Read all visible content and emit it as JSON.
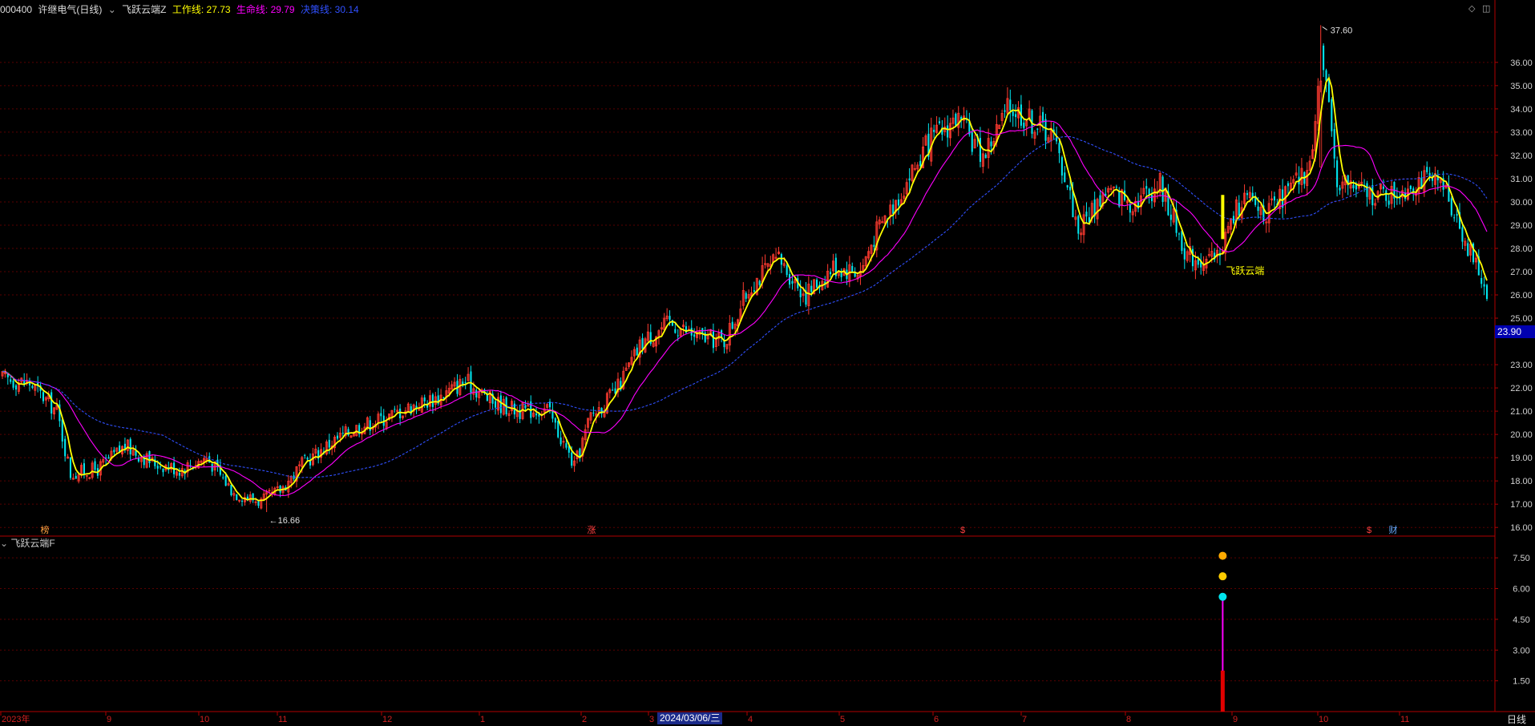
{
  "header": {
    "stock_code": "000400",
    "stock_name": "许继电气(日线)",
    "indicator_name": "飞跃云端Z",
    "work_line_label": "工作线:",
    "work_line_value": "27.73",
    "life_line_label": "生命线:",
    "life_line_value": "29.79",
    "decision_line_label": "决策线:",
    "decision_line_value": "30.14",
    "colors": {
      "work": "#ffff00",
      "life": "#ff00ff",
      "decision": "#3050ff"
    }
  },
  "sub_indicator": {
    "name": "飞跃云端F"
  },
  "current_price_badge": "23.90",
  "period_label": "日线",
  "crosshair_date": "2024/03/06/三",
  "icons": [
    "diamond-icon",
    "panel-toggle-icon",
    "collapse-icon"
  ],
  "chart_data": [
    {
      "type": "candlestick",
      "title": "",
      "ylim": [
        15.8,
        38.2
      ],
      "y_ticks": [
        "16.00",
        "17.00",
        "18.00",
        "19.00",
        "20.00",
        "21.00",
        "22.00",
        "23.00",
        "25.00",
        "26.00",
        "27.00",
        "28.00",
        "29.00",
        "30.00",
        "31.00",
        "32.00",
        "33.00",
        "34.00",
        "35.00",
        "36.00"
      ],
      "x_month_labels": [
        "2023年",
        "9",
        "10",
        "11",
        "12",
        "1",
        "2",
        "3",
        "4",
        "5",
        "6",
        "7",
        "8",
        "9",
        "10",
        "11"
      ],
      "annotations": {
        "high_label": "37.60",
        "low_label": "←16.66",
        "signal_label": "飞跃云端"
      },
      "markers": [
        "榜",
        "涨",
        "$",
        "$",
        "财"
      ],
      "anchors": [
        [
          0,
          22.4
        ],
        [
          10,
          22.2
        ],
        [
          20,
          21.0
        ],
        [
          25,
          18.3
        ],
        [
          35,
          18.5
        ],
        [
          45,
          19.5
        ],
        [
          55,
          18.8
        ],
        [
          65,
          18.5
        ],
        [
          75,
          19.0
        ],
        [
          85,
          17.5
        ],
        [
          95,
          17.1
        ],
        [
          102,
          17.6
        ],
        [
          110,
          18.7
        ],
        [
          120,
          19.6
        ],
        [
          130,
          20.3
        ],
        [
          140,
          20.7
        ],
        [
          150,
          21.2
        ],
        [
          160,
          21.6
        ],
        [
          170,
          22.3
        ],
        [
          180,
          21.4
        ],
        [
          190,
          21.0
        ],
        [
          200,
          21.1
        ],
        [
          210,
          18.6
        ],
        [
          216,
          20.8
        ],
        [
          225,
          21.8
        ],
        [
          235,
          24.0
        ],
        [
          245,
          24.8
        ],
        [
          255,
          24.2
        ],
        [
          265,
          24.0
        ],
        [
          275,
          26.5
        ],
        [
          285,
          27.5
        ],
        [
          295,
          26.0
        ],
        [
          305,
          27.2
        ],
        [
          315,
          27.0
        ],
        [
          320,
          28.5
        ],
        [
          330,
          30.5
        ],
        [
          340,
          32.5
        ],
        [
          350,
          33.6
        ],
        [
          360,
          32.0
        ],
        [
          370,
          34.1
        ],
        [
          380,
          33.3
        ],
        [
          385,
          33.0
        ],
        [
          390,
          31.2
        ],
        [
          395,
          28.8
        ],
        [
          405,
          30.5
        ],
        [
          415,
          30.0
        ],
        [
          425,
          30.8
        ],
        [
          435,
          27.7
        ],
        [
          445,
          27.4
        ],
        [
          455,
          30.2
        ],
        [
          465,
          29.5
        ],
        [
          475,
          30.8
        ],
        [
          480,
          31.4
        ],
        [
          484,
          36.5
        ],
        [
          490,
          31.0
        ],
        [
          500,
          30.4
        ],
        [
          510,
          30.3
        ],
        [
          520,
          31.0
        ],
        [
          530,
          30.5
        ],
        [
          540,
          27.5
        ],
        [
          545,
          26.2
        ]
      ],
      "n_bars": 546,
      "seed": 17,
      "series": [
        {
          "name": "工作线",
          "color": "#ffff00",
          "period": 5
        },
        {
          "name": "生命线",
          "color": "#ff00ff",
          "period": 20
        },
        {
          "name": "决策线",
          "color": "#3050ff",
          "period": 60
        }
      ],
      "up_color": "#ff3b30",
      "down_color": "#00e5ee"
    },
    {
      "type": "bar",
      "title": "",
      "ylim": [
        0,
        8.6
      ],
      "y_ticks": [
        "1.50",
        "3.00",
        "4.50",
        "6.00",
        "7.50"
      ],
      "signal_bar_index": 448,
      "red_value": 2.0,
      "magenta_value": 5.6,
      "icon_levels": [
        5.6,
        6.6,
        7.6
      ],
      "icon_names": [
        "butterfly-icon",
        "butterfly-icon",
        "money-bag-icon"
      ],
      "icon_colors": [
        "#00e5ee",
        "#ffcc00",
        "#ffaa00"
      ]
    }
  ]
}
